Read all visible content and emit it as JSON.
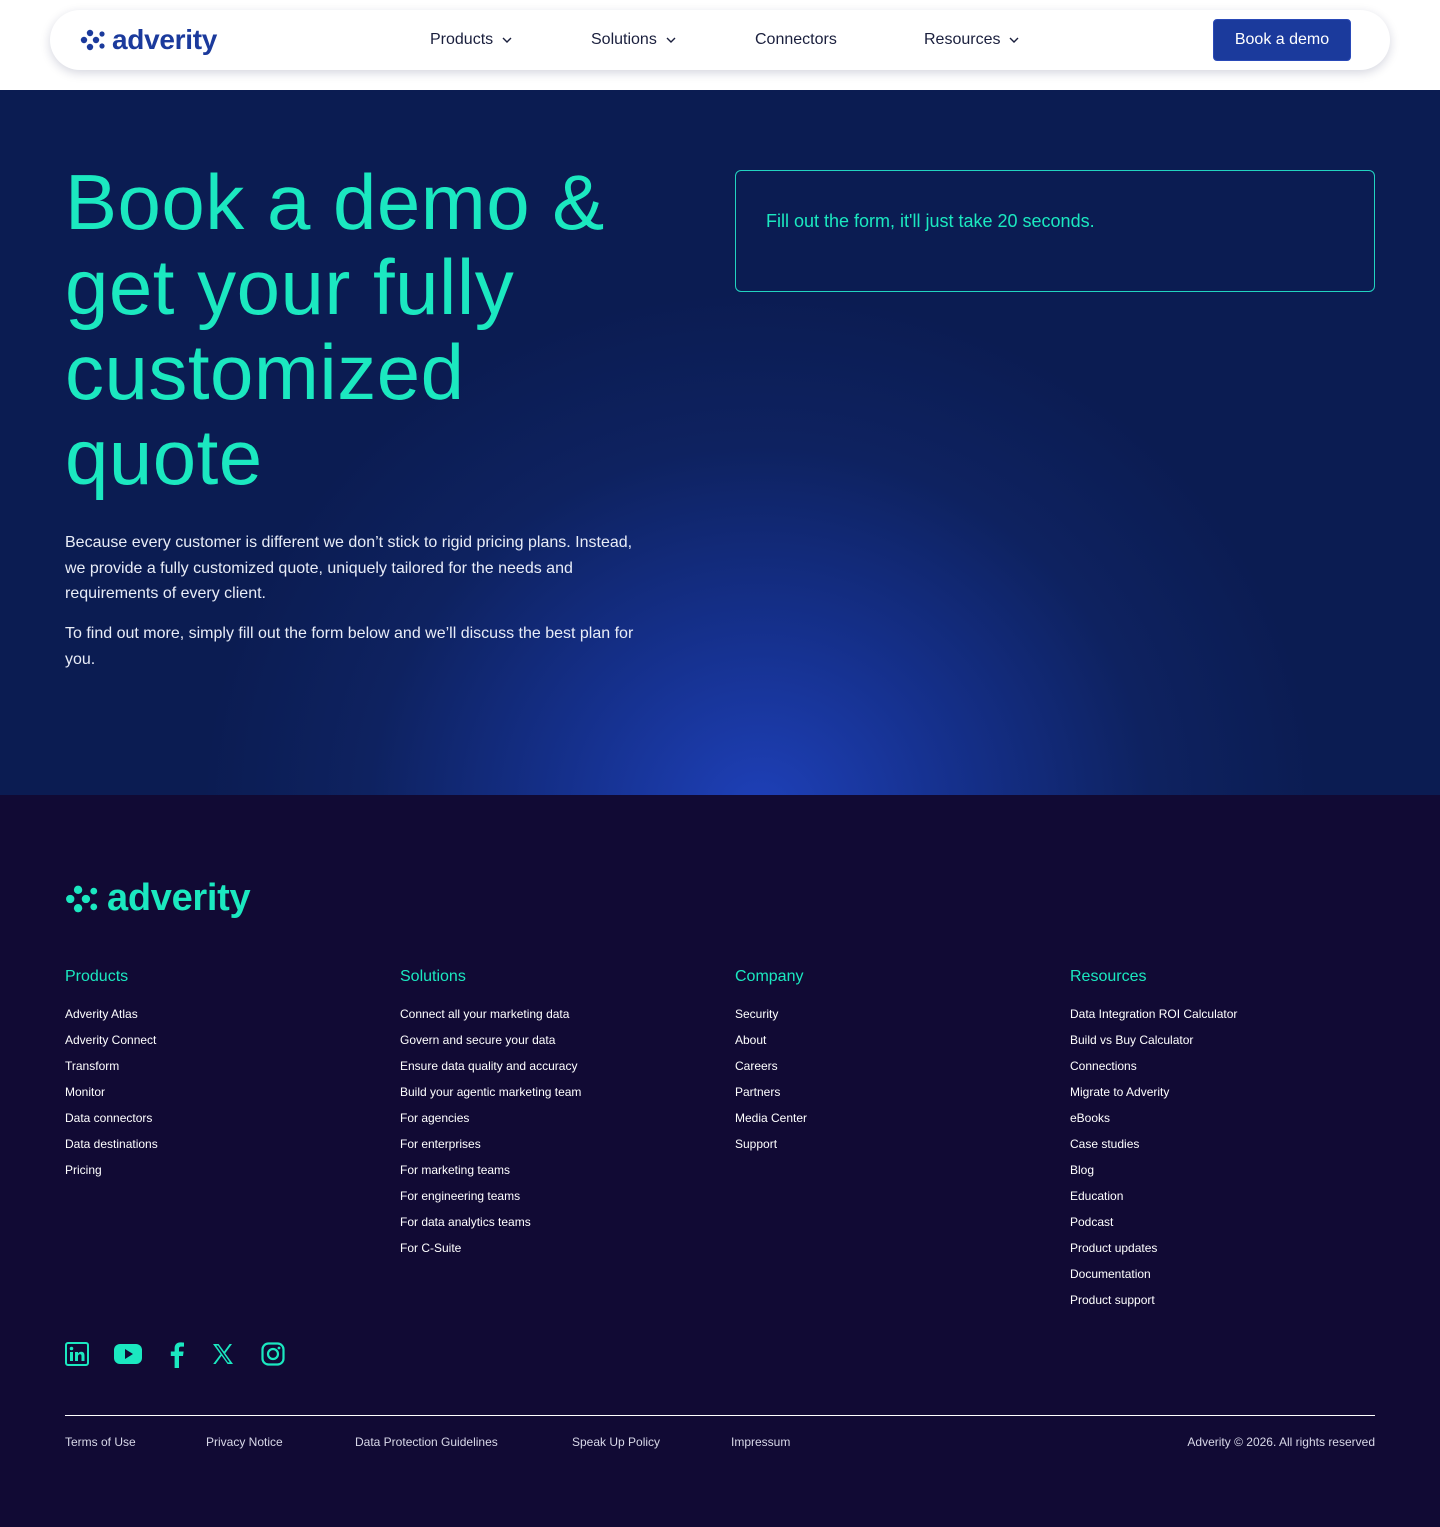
{
  "header": {
    "logo_text": "adverity",
    "nav": [
      {
        "label": "Products",
        "has_dropdown": true
      },
      {
        "label": "Solutions",
        "has_dropdown": true
      },
      {
        "label": "Connectors",
        "has_dropdown": false
      },
      {
        "label": "Resources",
        "has_dropdown": true
      }
    ],
    "cta_label": "Book a demo"
  },
  "hero": {
    "title_lines": [
      "Book a demo &",
      "get your fully",
      "customized",
      "quote"
    ],
    "paragraph1": "Because every customer is different we don’t stick to rigid pricing plans. Instead, we provide a fully customized quote, uniquely tailored for the needs and requirements of every client.",
    "paragraph2": "To find out more, simply fill out the form below and we’ll discuss the best plan for you.",
    "form_prompt": "Fill out the form, it'll just take 20 seconds."
  },
  "footer": {
    "logo_text": "adverity",
    "columns": [
      {
        "heading": "Products",
        "items": [
          "Adverity Atlas",
          "Adverity Connect",
          "Transform",
          "Monitor",
          "Data connectors",
          "Data destinations",
          "Pricing"
        ]
      },
      {
        "heading": "Solutions",
        "items": [
          "Connect all your marketing data",
          "Govern and secure your data",
          "Ensure data quality and accuracy",
          "Build your agentic marketing team",
          "For agencies",
          "For enterprises",
          "For marketing teams",
          "For engineering teams",
          "For data analytics teams",
          "For C-Suite"
        ]
      },
      {
        "heading": "Company",
        "items": [
          "Security",
          "About",
          "Careers",
          "Partners",
          "Media Center",
          "Support"
        ]
      },
      {
        "heading": "Resources",
        "items": [
          "Data Integration ROI Calculator",
          "Build vs Buy Calculator",
          "Connections",
          "Migrate to Adverity",
          "eBooks",
          "Case studies",
          "Blog",
          "Education",
          "Podcast",
          "Product updates",
          "Documentation",
          "Product support"
        ]
      }
    ],
    "socials": [
      "linkedin-icon",
      "youtube-icon",
      "facebook-icon",
      "x-icon",
      "instagram-icon"
    ],
    "legal_links": [
      "Terms of Use",
      "Privacy Notice",
      "Data Protection Guidelines",
      "Speak Up Policy",
      "Impressum"
    ],
    "copyright": "Adverity © 2026. All rights reserved"
  },
  "colors": {
    "brand_blue": "#1b3a9c",
    "accent_teal": "#1be8c0",
    "hero_bg": "#0e2260",
    "footer_bg": "#110a34"
  }
}
